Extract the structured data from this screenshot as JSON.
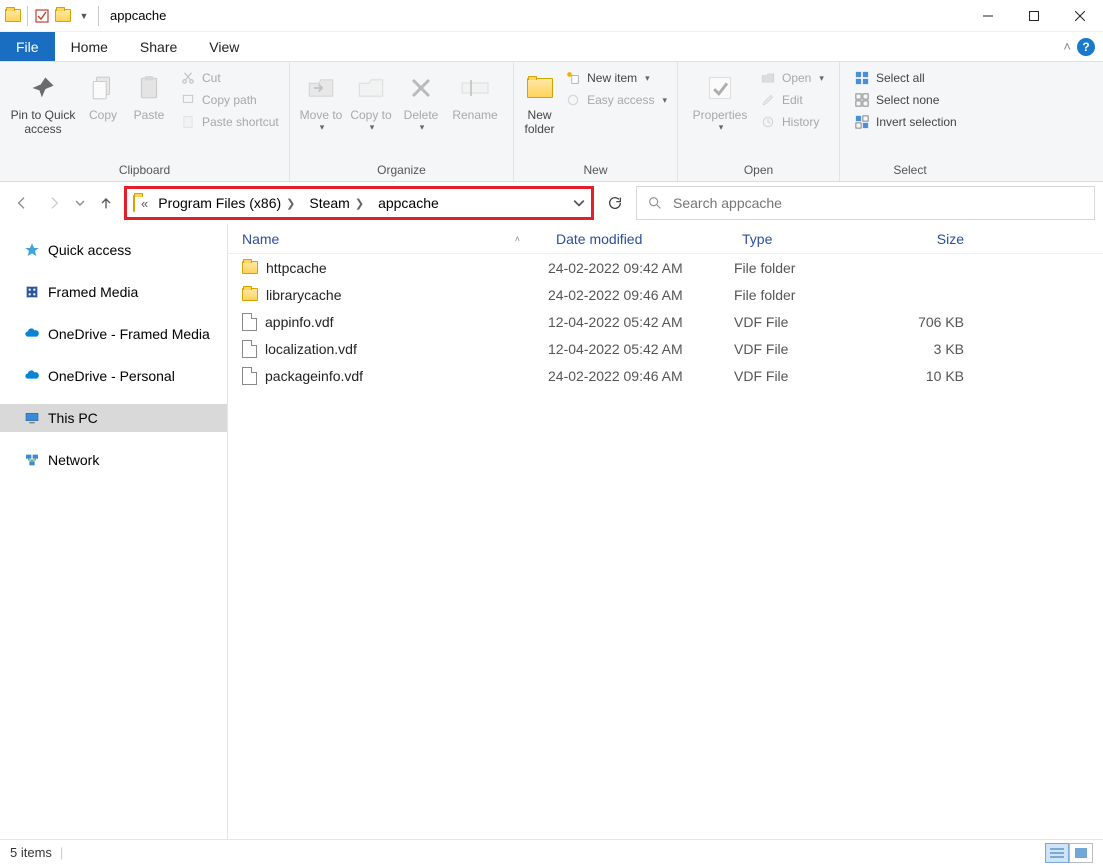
{
  "window": {
    "title": "appcache"
  },
  "menubar": {
    "file": "File",
    "home": "Home",
    "share": "Share",
    "view": "View"
  },
  "ribbon": {
    "clipboard": {
      "label": "Clipboard",
      "pin": "Pin to Quick access",
      "copy": "Copy",
      "paste": "Paste",
      "cut": "Cut",
      "copypath": "Copy path",
      "pasteshortcut": "Paste shortcut"
    },
    "organize": {
      "label": "Organize",
      "moveto": "Move to",
      "copyto": "Copy to",
      "delete": "Delete",
      "rename": "Rename"
    },
    "new": {
      "label": "New",
      "newfolder": "New folder",
      "newitem": "New item",
      "easyaccess": "Easy access"
    },
    "open": {
      "label": "Open",
      "properties": "Properties",
      "open": "Open",
      "edit": "Edit",
      "history": "History"
    },
    "select": {
      "label": "Select",
      "selectall": "Select all",
      "selectnone": "Select none",
      "invert": "Invert selection"
    }
  },
  "breadcrumb": {
    "items": [
      "Program Files (x86)",
      "Steam",
      "appcache"
    ]
  },
  "search": {
    "placeholder": "Search appcache"
  },
  "sidebar": {
    "quickaccess": "Quick access",
    "framed": "Framed Media",
    "od_framed": "OneDrive - Framed Media",
    "od_personal": "OneDrive - Personal",
    "thispc": "This PC",
    "network": "Network"
  },
  "columns": {
    "name": "Name",
    "date": "Date modified",
    "type": "Type",
    "size": "Size"
  },
  "files": [
    {
      "icon": "folder",
      "name": "httpcache",
      "date": "24-02-2022 09:42 AM",
      "type": "File folder",
      "size": ""
    },
    {
      "icon": "folder",
      "name": "librarycache",
      "date": "24-02-2022 09:46 AM",
      "type": "File folder",
      "size": ""
    },
    {
      "icon": "file",
      "name": "appinfo.vdf",
      "date": "12-04-2022 05:42 AM",
      "type": "VDF File",
      "size": "706 KB"
    },
    {
      "icon": "file",
      "name": "localization.vdf",
      "date": "12-04-2022 05:42 AM",
      "type": "VDF File",
      "size": "3 KB"
    },
    {
      "icon": "file",
      "name": "packageinfo.vdf",
      "date": "24-02-2022 09:46 AM",
      "type": "VDF File",
      "size": "10 KB"
    }
  ],
  "status": {
    "count": "5 items"
  }
}
